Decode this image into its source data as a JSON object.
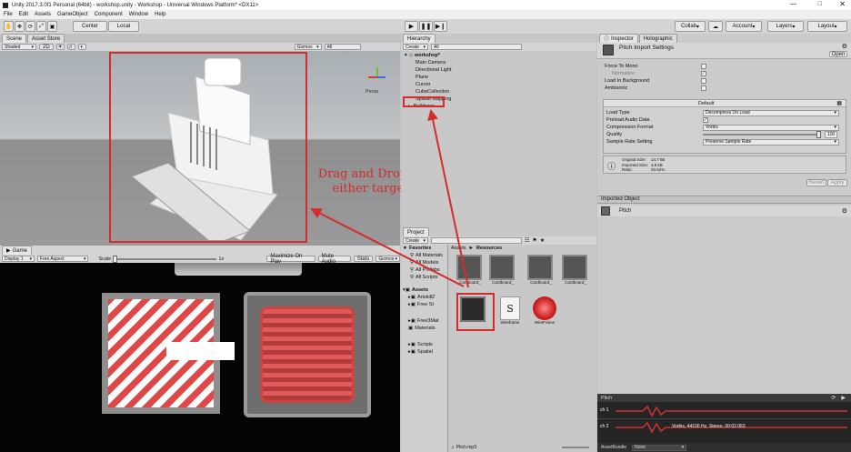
{
  "window": {
    "title": "Unity 2017.3.0f1 Personal (64bit) - workshop.unity - Workshop - Universal Windows Platform* <DX11>"
  },
  "menu": [
    "File",
    "Edit",
    "Assets",
    "GameObject",
    "Component",
    "Window",
    "Help"
  ],
  "toolbar": {
    "center": "Center",
    "local": "Local",
    "collab": "Collab",
    "account": "Account",
    "layers": "Layers",
    "layout": "Layout"
  },
  "scene": {
    "tab_scene": "Scene",
    "tab_asset_store": "Asset Store",
    "shaded": "Shaded",
    "mode_2d": "2D",
    "gizmos": "Gizmos",
    "search": "All",
    "persp": "Persp"
  },
  "game": {
    "tab": "Game",
    "display": "Display 1",
    "aspect": "Free Aspect",
    "scale_label": "Scale",
    "scale_value": "1x",
    "maximize": "Maximize On Play",
    "mute": "Mute Audio",
    "stats": "Stats",
    "gizmos": "Gizmos"
  },
  "annotation": {
    "text": "Drag and Drop to either target"
  },
  "hierarchy": {
    "tab": "Hierarchy",
    "create": "Create",
    "search": "All",
    "root": "workshop*",
    "items": [
      "Main Camera",
      "Directional Light",
      "Plane",
      "Cursor",
      "CubeCollection",
      "Spatial Mapping",
      "Bulldozer"
    ]
  },
  "project": {
    "tab": "Project",
    "create": "Create",
    "favorites": "Favorites",
    "fav_items": [
      "All Materials",
      "All Models",
      "All Prefabs",
      "All Scripts"
    ],
    "assets": "Assets",
    "asset_items": [
      "ArtskillZ",
      "Free St",
      "Free3Mat",
      "Materials",
      "Scripts",
      "Spatial"
    ],
    "breadcrumb_root": "Assets",
    "breadcrumb_sep": "►",
    "breadcrumb_leaf": "Resources",
    "items": [
      {
        "label": "Cardboard_"
      },
      {
        "label": "Cardboard_"
      },
      {
        "label": "Cardboard_"
      },
      {
        "label": "Cardboard_"
      },
      {
        "label": ""
      },
      {
        "label": "Wireframe"
      },
      {
        "label": "WireFrame"
      }
    ],
    "script_glyph": "S",
    "selected_file": "Pitch.mp3"
  },
  "inspector": {
    "tab": "Inspector",
    "tab2": "Holographic",
    "title": "Pitch Import Settings",
    "open": "Open",
    "force_mono": "Force To Mono",
    "normalize": "Normalize",
    "load_background": "Load In Background",
    "ambisonic": "Ambisonic",
    "platform": "Default",
    "load_type_label": "Load Type",
    "load_type_value": "Decompress On Load",
    "preload_label": "Preload Audio Data",
    "compression_label": "Compression Format",
    "compression_value": "Vorbis",
    "quality_label": "Quality",
    "quality_value": "100",
    "sample_rate_label": "Sample Rate Setting",
    "sample_rate_value": "Preserve Sample Rate",
    "original_size": "Original Size:",
    "original_size_val": "14.7 kB",
    "imported_size": "Imported Size:",
    "imported_size_val": "3.9 kB",
    "ratio": "Ratio:",
    "ratio_val": "26.52%",
    "revert": "Revert",
    "apply": "Apply",
    "imported_object": "Imported Object",
    "object_name": "Pitch"
  },
  "preview": {
    "name": "Pitch",
    "ch1": "ch 1",
    "ch2": "ch 2",
    "info": "Vorbis, 44100 Hz, Stereo, 00:02.063",
    "bundle": "AssetBundle",
    "bundle_value": "None"
  },
  "colors": {
    "red": "#d42c2c",
    "panel": "#c2c2c2",
    "dark": "#2a2a2a"
  }
}
